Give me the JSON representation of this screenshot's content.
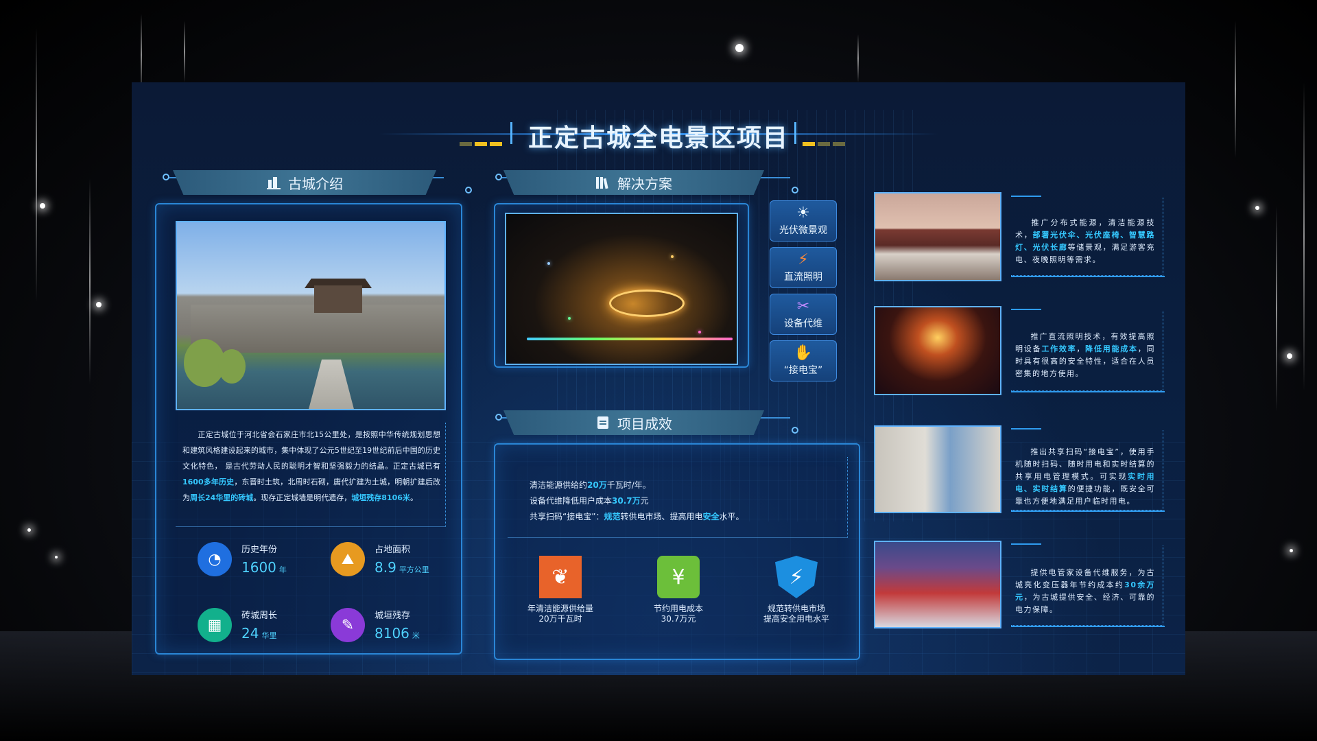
{
  "title": "正定古城全电景区项目",
  "sections": {
    "intro": "古城介绍",
    "solution": "解决方案",
    "results": "项目成效"
  },
  "intro": {
    "text_parts": [
      "正定古城位于河北省会石家庄市北15公里处，是按照中华传统规划思想和建筑风格建设起来的城市，集中体现了公元5世纪至19世纪前后中国的历史文化特色， 是古代劳动人民的聪明才智和坚强毅力的结晶。正定古城已有",
      "1600多年历史",
      "，东晋时土筑，北周时石砌，唐代扩建为土城，明朝扩建后改为",
      "周长24华里的砖城",
      "。现存正定城墙是明代遗存，",
      "城垣残存8106米",
      "。"
    ],
    "stats": [
      {
        "label": "历史年份",
        "value": "1600",
        "unit": "年",
        "color": "#1f6fe0",
        "icon": "clock-icon"
      },
      {
        "label": "占地面积",
        "value": "8.9",
        "unit": "平方公里",
        "color": "#e79a20",
        "icon": "area-icon"
      },
      {
        "label": "砖城周长",
        "value": "24",
        "unit": "华里",
        "color": "#12b08c",
        "icon": "wall-icon"
      },
      {
        "label": "城垣残存",
        "value": "8106",
        "unit": "米",
        "color": "#8a3ad8",
        "icon": "ruler-icon"
      }
    ]
  },
  "solution_buttons": [
    {
      "label": "光伏微景观",
      "icon": "☀"
    },
    {
      "label": "直流照明",
      "icon": "⚡"
    },
    {
      "label": "设备代维",
      "icon": "✂"
    },
    {
      "label": "“接电宝”",
      "icon": "✋"
    }
  ],
  "results": {
    "line1_a": "清洁能源供给约",
    "line1_hl": "20万",
    "line1_b": "千瓦时/年。",
    "line2_a": "设备代维降低用户成本",
    "line2_hl": "30.7万",
    "line2_b": "元",
    "line3_a": "共享扫码“接电宝”：",
    "line3_hl1": "规范",
    "line3_b": "转供电市场、提高用电",
    "line3_hl2": "安全",
    "line3_c": "水平。",
    "items": [
      {
        "label1": "年清洁能源供给量",
        "label2": "20万千瓦时",
        "color": "#e8632a",
        "icon": "❦"
      },
      {
        "label1": "节约用电成本",
        "label2": "30.7万元",
        "color": "#6cbf3a",
        "icon": "¥"
      },
      {
        "label1": "规范转供电市场",
        "label2": "提高安全用电水平",
        "color": "#1c8fe0",
        "icon": "⚡"
      }
    ]
  },
  "right": [
    {
      "parts": [
        "推广分布式能源，清洁能源技术，",
        "部署光伏伞、光伏座椅、智慧路灯、光伏长廊",
        "等储景观，满足游客充电、夜晚照明等需求。"
      ]
    },
    {
      "parts": [
        "推广直流照明技术，有效提高照明设备",
        "工作效率",
        "，",
        "降低用能成本",
        "，同时具有很高的安全特性，适合在人员密集的地方使用。"
      ]
    },
    {
      "parts": [
        "推出共享扫码“接电宝”，使用手机随时扫码、随时用电和实时结算的共享用电管理模式。可实现",
        "实时用电、实时结算",
        "的便捷功能，既安全可靠也方便地满足用户临时用电。"
      ]
    },
    {
      "parts": [
        "提供电管家设备代维服务，为古城亮化变压器年节约成本约",
        "30余万元",
        "，为古城提供安全、经济、可靠的电力保障。"
      ]
    }
  ]
}
